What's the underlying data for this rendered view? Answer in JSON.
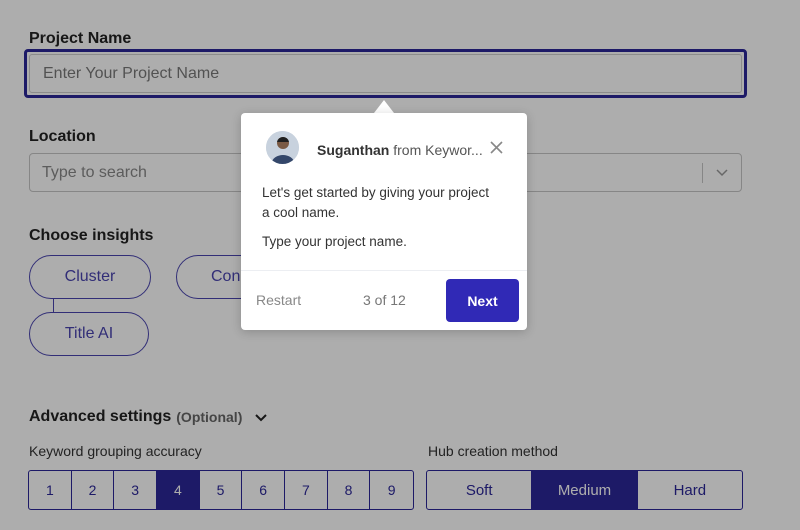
{
  "form": {
    "project_name_label": "Project Name",
    "project_name_placeholder": "Enter Your Project Name",
    "location_label": "Location",
    "location_placeholder": "Type to search",
    "insights_label": "Choose insights",
    "insights": {
      "cluster": "Cluster",
      "content_partial": "Con",
      "title_ai": "Title AI"
    },
    "advanced_label": "Advanced settings",
    "advanced_optional": "(Optional)",
    "accuracy_label": "Keyword grouping accuracy",
    "accuracy_options": [
      "1",
      "2",
      "3",
      "4",
      "5",
      "6",
      "7",
      "8",
      "9"
    ],
    "accuracy_selected": "4",
    "hub_label": "Hub creation method",
    "hub_options": [
      "Soft",
      "Medium",
      "Hard"
    ],
    "hub_selected": "Medium"
  },
  "tour": {
    "author": "Suganthan",
    "from_text": "from Keywor...",
    "message": "Let's get started by giving your project a cool name.",
    "instruction": "Type your project name.",
    "restart_label": "Restart",
    "progress": "3 of 12",
    "next_label": "Next"
  },
  "colors": {
    "accent": "#2c2799",
    "button": "#3029b6",
    "overlay": "rgba(0,0,0,0.32)"
  }
}
